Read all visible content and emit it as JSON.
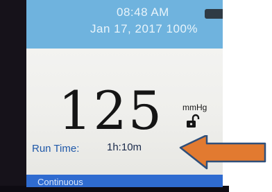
{
  "status": {
    "time": "08:48 AM",
    "date": "Jan 17, 2017",
    "battery_text": "100%"
  },
  "reading": {
    "value": "125",
    "unit": "mmHg"
  },
  "run_time": {
    "label": "Run Time:",
    "value": "1h:10m"
  },
  "mode": {
    "label": "Continuous"
  },
  "icons": {
    "battery": "battery-icon",
    "lock": "unlocked-padlock-icon",
    "annotation": "orange-arrow-icon"
  },
  "colors": {
    "status_bar": "#6fb3de",
    "mode_bar": "#2f6bd0",
    "label_blue": "#1f58a8",
    "arrow": "#e27a30"
  }
}
